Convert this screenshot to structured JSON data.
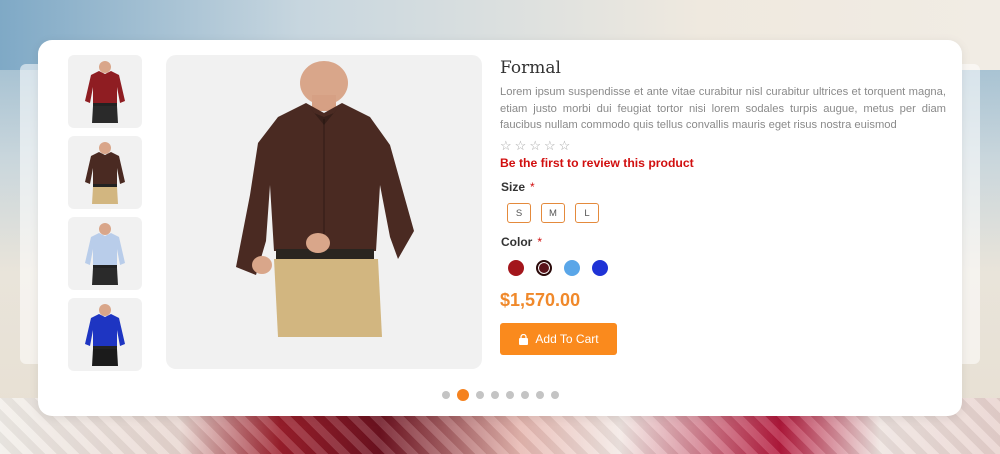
{
  "product": {
    "title": "Formal",
    "description": "Lorem ipsum suspendisse et ante vitae curabitur nisl curabitur ultrices et torquent magna, etiam justo morbi dui feugiat tortor nisi lorem sodales turpis augue, metus per diam faucibus nullam commodo quis tellus convallis mauris eget risus nostra euismod",
    "rating": {
      "value": 0,
      "max": 5,
      "star_glyph": "☆"
    },
    "review_link": "Be the first to review this product",
    "size": {
      "label": "Size",
      "required_mark": "*",
      "options": [
        "S",
        "M",
        "L"
      ]
    },
    "color": {
      "label": "Color",
      "required_mark": "*",
      "options": [
        "#a3161c",
        "#5a1219",
        "#5aa6e8",
        "#1f33d6"
      ],
      "selected_index": 1
    },
    "price": "$1,570.00",
    "add_to_cart_label": "Add To Cart",
    "cart_icon": "shopping-bag-icon"
  },
  "gallery": {
    "thumbnails": [
      {
        "shirt": "#8f1d22",
        "pants": "#2a2a2a"
      },
      {
        "shirt": "#4a2a22",
        "pants": "#d2b680"
      },
      {
        "shirt": "#b9cdea",
        "pants": "#2a2a2a"
      },
      {
        "shirt": "#1e35c2",
        "pants": "#1b1b1b"
      }
    ],
    "main": {
      "shirt": "#4a2a22",
      "pants": "#d2b680"
    }
  },
  "carousel": {
    "total": 8,
    "active_index": 1
  }
}
